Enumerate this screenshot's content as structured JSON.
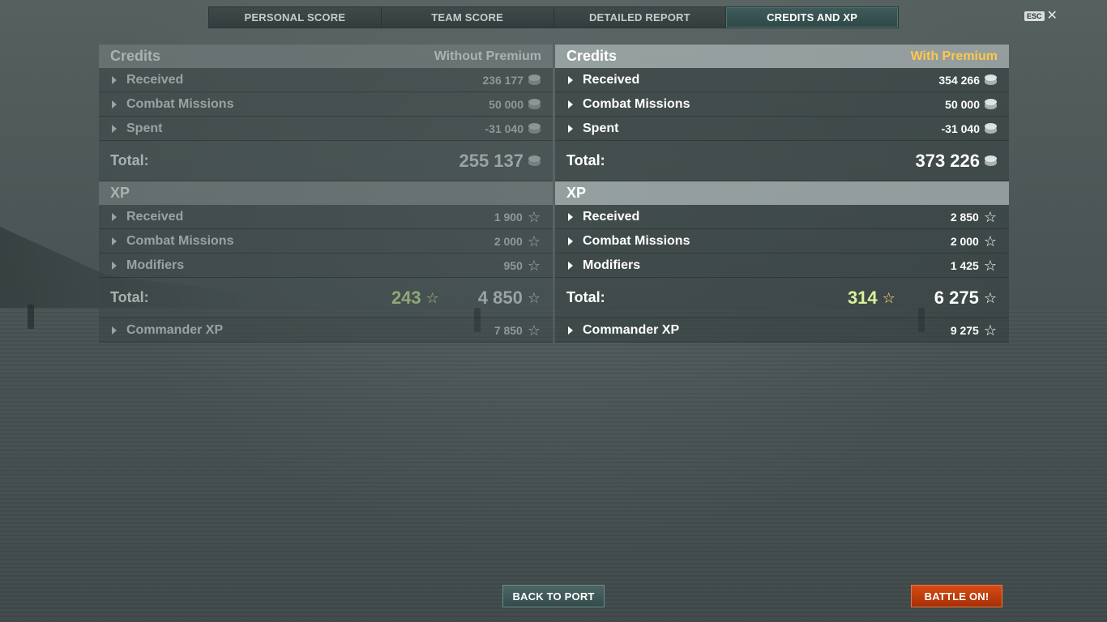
{
  "tabs": [
    {
      "label": "PERSONAL SCORE",
      "active": false
    },
    {
      "label": "TEAM SCORE",
      "active": false
    },
    {
      "label": "DETAILED REPORT",
      "active": false
    },
    {
      "label": "CREDITS AND XP",
      "active": true
    }
  ],
  "close": {
    "key_label": "ESC",
    "icon": "close-icon"
  },
  "left": {
    "credits_title": "Credits",
    "premium_label": "Without Premium",
    "credits_rows": [
      {
        "label": "Received",
        "value": "236 177"
      },
      {
        "label": "Combat Missions",
        "value": "50 000"
      },
      {
        "label": "Spent",
        "value": "-31 040"
      }
    ],
    "credits_total_label": "Total:",
    "credits_total": "255 137",
    "xp_title": "XP",
    "xp_rows": [
      {
        "label": "Received",
        "value": "1 900"
      },
      {
        "label": "Combat Missions",
        "value": "2 000"
      },
      {
        "label": "Modifiers",
        "value": "950"
      }
    ],
    "xp_total_label": "Total:",
    "xp_bonus": "243",
    "xp_total": "4 850",
    "commander_label": "Commander XP",
    "commander_value": "7 850"
  },
  "right": {
    "credits_title": "Credits",
    "premium_label": "With Premium",
    "credits_rows": [
      {
        "label": "Received",
        "value": "354 266"
      },
      {
        "label": "Combat Missions",
        "value": "50 000"
      },
      {
        "label": "Spent",
        "value": "-31 040"
      }
    ],
    "credits_total_label": "Total:",
    "credits_total": "373 226",
    "xp_title": "XP",
    "xp_rows": [
      {
        "label": "Received",
        "value": "2 850"
      },
      {
        "label": "Combat Missions",
        "value": "2 000"
      },
      {
        "label": "Modifiers",
        "value": "1 425"
      }
    ],
    "xp_total_label": "Total:",
    "xp_bonus": "314",
    "xp_total": "6 275",
    "commander_label": "Commander XP",
    "commander_value": "9 275"
  },
  "buttons": {
    "back_to_port": "BACK TO PORT",
    "battle_on": "BATTLE ON!"
  },
  "colors": {
    "premium_accent": "#ffc84a",
    "bonus_xp_right": "#d9f29a",
    "battle_button": "#c23d0b",
    "active_tab": "#2f4848"
  }
}
